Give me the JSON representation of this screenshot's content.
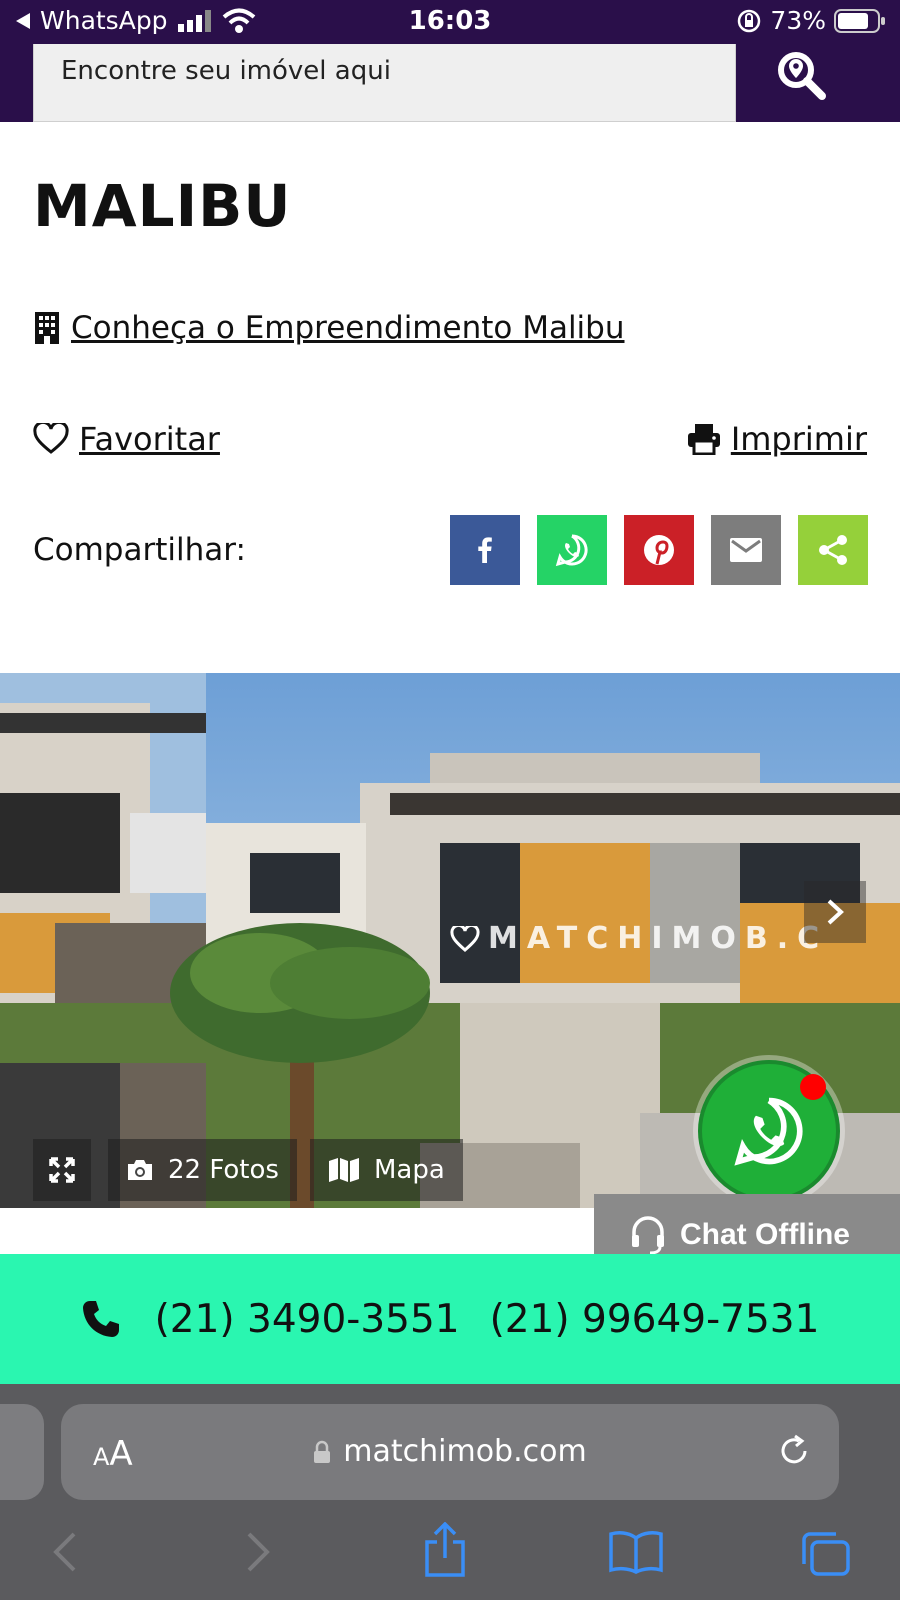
{
  "status_bar": {
    "back_app": "WhatsApp",
    "time": "16:03",
    "battery": "73%"
  },
  "header": {
    "search_placeholder": "Encontre seu imóvel aqui",
    "search_icon": "map-search-icon"
  },
  "property": {
    "title": "MALIBU",
    "development_link": " Conheça o Empreendimento Malibu",
    "favorite_label": "Favoritar",
    "print_label": "Imprimir",
    "share_label": "Compartilhar:",
    "share_buttons": [
      {
        "name": "facebook",
        "color": "#3b5998"
      },
      {
        "name": "whatsapp",
        "color": "#25d366"
      },
      {
        "name": "pinterest",
        "color": "#cb2027"
      },
      {
        "name": "email",
        "color": "#7d7d7d"
      },
      {
        "name": "sharethis",
        "color": "#95d03a"
      }
    ]
  },
  "gallery": {
    "watermark": "MATCHIMOB.C",
    "photos_label": "22 Fotos",
    "map_label": "Mapa"
  },
  "chat": {
    "offline_label": "Chat Offline"
  },
  "contact": {
    "phone_1": "(21) 3490-3551",
    "phone_2": "(21) 99649-7531",
    "accent": "#2af6b0"
  },
  "browser": {
    "text_size_label_small": "A",
    "text_size_label_large": "A",
    "url": "matchimob.com"
  }
}
